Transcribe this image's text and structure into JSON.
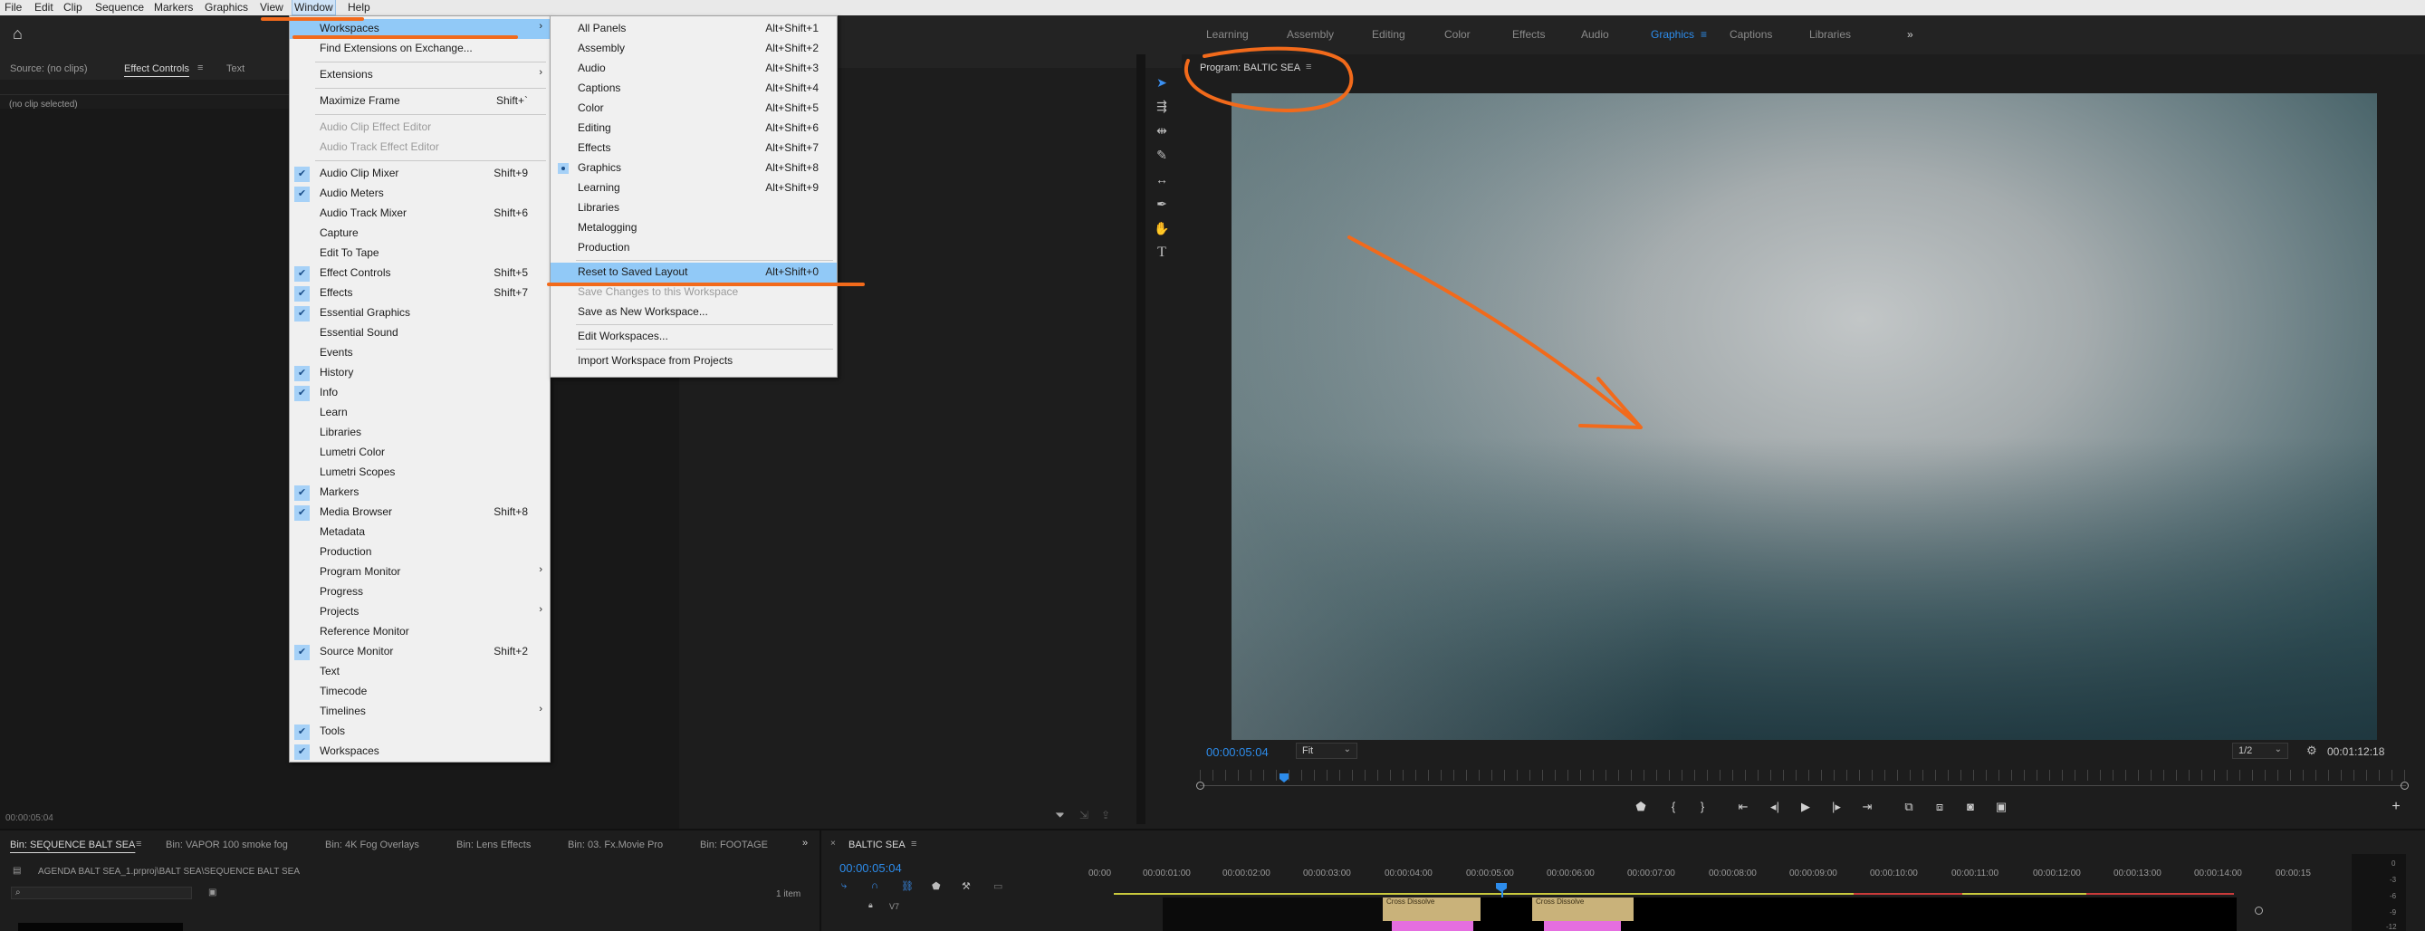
{
  "menubar": [
    "File",
    "Edit",
    "Clip",
    "Sequence",
    "Markers",
    "Graphics",
    "View",
    "Window",
    "Help"
  ],
  "workspaces_bar": {
    "items": [
      "Learning",
      "Assembly",
      "Editing",
      "Color",
      "Effects",
      "Audio",
      "Graphics",
      "Captions",
      "Libraries"
    ],
    "active": "Graphics",
    "overflow": "»"
  },
  "source_panel": {
    "tabs": [
      "Source: (no clips)",
      "Effect Controls",
      "Text"
    ],
    "no_clip": "(no clip selected)",
    "timecode": "00:00:05:04"
  },
  "window_menu": {
    "items": [
      {
        "label": "Workspaces",
        "submenu": true,
        "highlight": true
      },
      {
        "label": "Find Extensions on Exchange..."
      },
      {
        "sep": true
      },
      {
        "label": "Extensions",
        "submenu": true
      },
      {
        "sep": true
      },
      {
        "label": "Maximize Frame",
        "shortcut": "Shift+`"
      },
      {
        "sep": true
      },
      {
        "label": "Audio Clip Effect Editor",
        "disabled": true
      },
      {
        "label": "Audio Track Effect Editor",
        "disabled": true
      },
      {
        "sep": true
      },
      {
        "label": "Audio Clip Mixer",
        "checked": true,
        "shortcut": "Shift+9"
      },
      {
        "label": "Audio Meters",
        "checked": true
      },
      {
        "label": "Audio Track Mixer",
        "shortcut": "Shift+6"
      },
      {
        "label": "Capture"
      },
      {
        "label": "Edit To Tape"
      },
      {
        "label": "Effect Controls",
        "checked": true,
        "shortcut": "Shift+5"
      },
      {
        "label": "Effects",
        "checked": true,
        "shortcut": "Shift+7"
      },
      {
        "label": "Essential Graphics",
        "checked": true
      },
      {
        "label": "Essential Sound"
      },
      {
        "label": "Events"
      },
      {
        "label": "History",
        "checked": true
      },
      {
        "label": "Info",
        "checked": true
      },
      {
        "label": "Learn"
      },
      {
        "label": "Libraries"
      },
      {
        "label": "Lumetri Color"
      },
      {
        "label": "Lumetri Scopes"
      },
      {
        "label": "Markers",
        "checked": true
      },
      {
        "label": "Media Browser",
        "checked": true,
        "shortcut": "Shift+8"
      },
      {
        "label": "Metadata"
      },
      {
        "label": "Production"
      },
      {
        "label": "Program Monitor",
        "submenu": true
      },
      {
        "label": "Progress"
      },
      {
        "label": "Projects",
        "submenu": true
      },
      {
        "label": "Reference Monitor"
      },
      {
        "label": "Source Monitor",
        "checked": true,
        "shortcut": "Shift+2"
      },
      {
        "label": "Text"
      },
      {
        "label": "Timecode"
      },
      {
        "label": "Timelines",
        "submenu": true
      },
      {
        "label": "Tools",
        "checked": true
      },
      {
        "label": "Workspaces",
        "checked": true
      }
    ]
  },
  "workspaces_submenu": {
    "items": [
      {
        "label": "All Panels",
        "shortcut": "Alt+Shift+1"
      },
      {
        "label": "Assembly",
        "shortcut": "Alt+Shift+2"
      },
      {
        "label": "Audio",
        "shortcut": "Alt+Shift+3"
      },
      {
        "label": "Captions",
        "shortcut": "Alt+Shift+4"
      },
      {
        "label": "Color",
        "shortcut": "Alt+Shift+5"
      },
      {
        "label": "Editing",
        "shortcut": "Alt+Shift+6"
      },
      {
        "label": "Effects",
        "shortcut": "Alt+Shift+7"
      },
      {
        "label": "Graphics",
        "shortcut": "Alt+Shift+8",
        "selected": true
      },
      {
        "label": "Learning",
        "shortcut": "Alt+Shift+9"
      },
      {
        "label": "Libraries"
      },
      {
        "label": "Metalogging"
      },
      {
        "label": "Production"
      },
      {
        "sep": true
      },
      {
        "label": "Reset to Saved Layout",
        "shortcut": "Alt+Shift+0",
        "highlight": true
      },
      {
        "label": "Save Changes to this Workspace",
        "disabled": true
      },
      {
        "label": "Save as New Workspace..."
      },
      {
        "sep": true
      },
      {
        "label": "Edit Workspaces..."
      },
      {
        "sep": true
      },
      {
        "label": "Import Workspace from Projects"
      }
    ]
  },
  "program_monitor": {
    "title": "Program: BALTIC SEA",
    "timecode": "00:00:05:04",
    "fit": "Fit",
    "resolution": "1/2",
    "duration": "00:01:12:18"
  },
  "project_panel": {
    "tabs": [
      "Bin: SEQUENCE BALT SEA",
      "Bin: VAPOR 100 smoke fog",
      "Bin: 4K Fog Overlays",
      "Bin: Lens Effects",
      "Bin: 03. Fx.Movie Pro",
      "Bin: FOOTAGE"
    ],
    "path": "AGENDA BALT SEA_1.prproj\\BALT SEA\\SEQUENCE BALT SEA",
    "item_count": "1 item"
  },
  "timeline": {
    "tab": "BALTIC SEA",
    "timecode": "00:00:05:04",
    "track": "V7",
    "ruler": [
      "00:00",
      "00:00:01:00",
      "00:00:02:00",
      "00:00:03:00",
      "00:00:04:00",
      "00:00:05:00",
      "00:00:06:00",
      "00:00:07:00",
      "00:00:08:00",
      "00:00:09:00",
      "00:00:10:00",
      "00:00:11:00",
      "00:00:12:00",
      "00:00:13:00",
      "00:00:14:00",
      "00:00:15"
    ],
    "clip_labels": [
      "Cross Dissolve",
      "Cross Dissolve"
    ]
  },
  "meter_labels": [
    "0",
    "-3",
    "-6",
    "-9",
    "-12"
  ],
  "colors": {
    "accent": "#2d8ceb",
    "annotation": "#f26a1b",
    "menu_highlight": "#91c9f7"
  }
}
